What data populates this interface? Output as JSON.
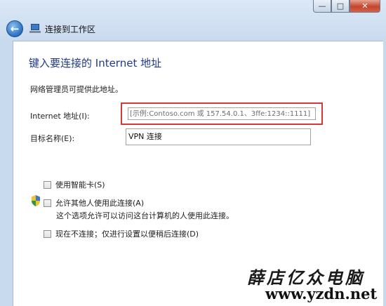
{
  "window": {
    "minimize_icon": "minimize-icon",
    "maximize_icon": "maximize-icon",
    "close_icon": "close-icon"
  },
  "nav": {
    "back_icon": "back-arrow-icon",
    "app_icon": "network-computer-icon",
    "title": "连接到工作区"
  },
  "main": {
    "heading": "键入要连接的 Internet 地址",
    "description": "网络管理员可提供此地址。",
    "address_label": "Internet 地址(I):",
    "address_placeholder": "[示例:Contoso.com 或 157.54.0.1、3ffe:1234::1111]",
    "destination_label": "目标名称(E):",
    "destination_value": "VPN 连接",
    "options": {
      "smartcard": "使用智能卡(S)",
      "allow_others": "允许其他人使用此连接(A)",
      "allow_others_note": "这个选项允许可以访问这台计算机的人使用此连接。",
      "dont_connect": "现在不连接；仅进行设置以便稍后连接(D)"
    },
    "shield_icon": "uac-shield-icon"
  },
  "watermark": {
    "chinese": "薛店亿众电脑",
    "url": "www.yzdn.net"
  }
}
